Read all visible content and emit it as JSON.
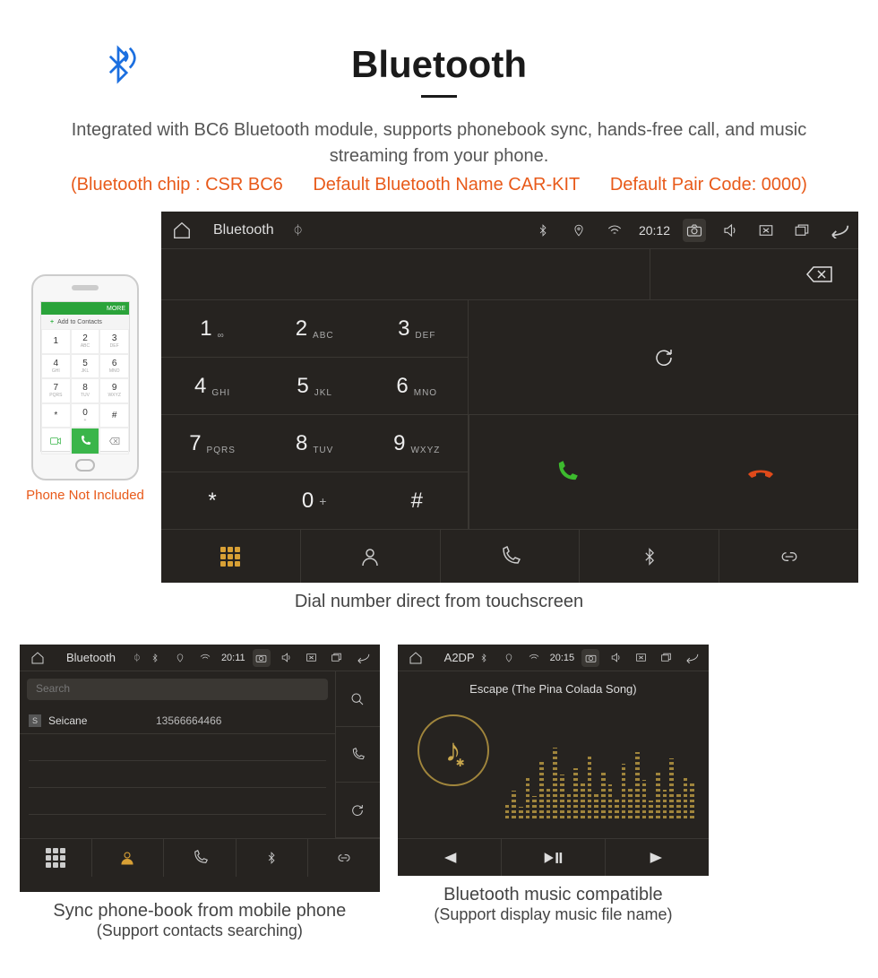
{
  "header": {
    "title": "Bluetooth",
    "intro": "Integrated with BC6 Bluetooth module, supports phonebook sync, hands-free call, and music streaming from your phone.",
    "spec_chip": "(Bluetooth chip : CSR BC6",
    "spec_name": "Default Bluetooth Name CAR-KIT",
    "spec_code": "Default Pair Code: 0000)"
  },
  "phone": {
    "add_contacts": "Add to Contacts",
    "menu": "MORE",
    "note": "Phone Not Included",
    "keys": [
      {
        "n": "1",
        "l": ""
      },
      {
        "n": "2",
        "l": "ABC"
      },
      {
        "n": "3",
        "l": "DEF"
      },
      {
        "n": "4",
        "l": "GHI"
      },
      {
        "n": "5",
        "l": "JKL"
      },
      {
        "n": "6",
        "l": "MNO"
      },
      {
        "n": "7",
        "l": "PQRS"
      },
      {
        "n": "8",
        "l": "TUV"
      },
      {
        "n": "9",
        "l": "WXYZ"
      },
      {
        "n": "*",
        "l": ""
      },
      {
        "n": "0",
        "l": "+"
      },
      {
        "n": "#",
        "l": ""
      }
    ]
  },
  "headunit_dialer": {
    "title": "Bluetooth",
    "time": "20:12",
    "keys": [
      {
        "n": "1",
        "l": "∞"
      },
      {
        "n": "2",
        "l": "ABC"
      },
      {
        "n": "3",
        "l": "DEF"
      },
      {
        "n": "4",
        "l": "GHI"
      },
      {
        "n": "5",
        "l": "JKL"
      },
      {
        "n": "6",
        "l": "MNO"
      },
      {
        "n": "7",
        "l": "PQRS"
      },
      {
        "n": "8",
        "l": "TUV"
      },
      {
        "n": "9",
        "l": "WXYZ"
      },
      {
        "n": "*",
        "l": ""
      },
      {
        "n": "0",
        "l": "+"
      },
      {
        "n": "#",
        "l": ""
      }
    ],
    "caption": "Dial number direct from touchscreen"
  },
  "headunit_contacts": {
    "title": "Bluetooth",
    "time": "20:11",
    "search_placeholder": "Search",
    "contact_badge": "S",
    "contact_name": "Seicane",
    "contact_number": "13566664466",
    "caption_line1": "Sync phone-book from mobile phone",
    "caption_line2": "(Support contacts searching)"
  },
  "headunit_music": {
    "title": "A2DP",
    "time": "20:15",
    "song": "Escape (The Pina Colada Song)",
    "caption_line1": "Bluetooth music compatible",
    "caption_line2": "(Support display music file name)"
  }
}
